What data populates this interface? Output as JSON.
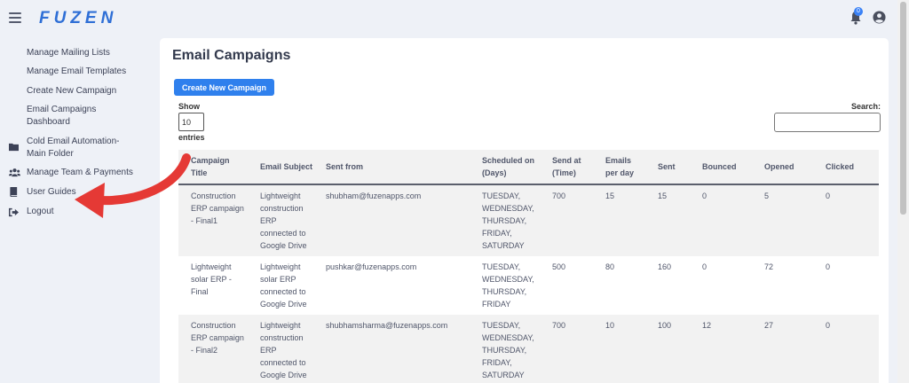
{
  "app": {
    "logo": "FUZEN",
    "notification_count": "0"
  },
  "sidebar": {
    "items": [
      {
        "label": "Manage Mailing Lists"
      },
      {
        "label": "Manage Email Templates"
      },
      {
        "label": "Create New Campaign"
      },
      {
        "label_line1": "Email Campaigns",
        "label_line2": "Dashboard"
      },
      {
        "label_line1": "Cold Email Automation-",
        "label_line2": "Main Folder",
        "icon": "folder-icon"
      },
      {
        "label": "Manage Team & Payments",
        "icon": "users-icon"
      },
      {
        "label": "User Guides",
        "icon": "book-icon"
      },
      {
        "label": "Logout",
        "icon": "logout-icon"
      }
    ]
  },
  "main": {
    "title": "Email Campaigns",
    "create_button": "Create New Campaign",
    "show_label": "Show",
    "entries_value": "10",
    "entries_label": "entries",
    "search_label": "Search:",
    "table": {
      "headers": [
        "Campaign Title",
        "Email Subject",
        "Sent from",
        "Scheduled on (Days)",
        "Send at (Time)",
        "Emails per day",
        "Sent",
        "Bounced",
        "Opened",
        "Clicked"
      ],
      "rows": [
        {
          "title": "Construction ERP campaign - Final1",
          "subject": "Lightweight construction ERP connected to Google Drive",
          "from": "shubham@fuzenapps.com",
          "days": "TUESDAY, WEDNESDAY, THURSDAY, FRIDAY, SATURDAY",
          "time": "700",
          "per_day": "15",
          "sent": "15",
          "bounced": "0",
          "opened": "5",
          "clicked": "0"
        },
        {
          "title": "Lightweight solar ERP - Final",
          "subject": "Lightweight solar ERP connected to Google Drive",
          "from": "pushkar@fuzenapps.com",
          "days": "TUESDAY, WEDNESDAY, THURSDAY, FRIDAY",
          "time": "500",
          "per_day": "80",
          "sent": "160",
          "bounced": "0",
          "opened": "72",
          "clicked": "0"
        },
        {
          "title": "Construction ERP campaign - Final2",
          "subject": "Lightweight construction ERP connected to Google Drive",
          "from": "shubhamsharma@fuzenapps.com",
          "days": "TUESDAY, WEDNESDAY, THURSDAY, FRIDAY, SATURDAY",
          "time": "700",
          "per_day": "10",
          "sent": "100",
          "bounced": "12",
          "opened": "27",
          "clicked": "0"
        }
      ]
    }
  },
  "colors": {
    "accent": "#2f80ed",
    "logo": "#2f6fd6",
    "arrow": "#e53935",
    "background": "#eef1f7"
  }
}
